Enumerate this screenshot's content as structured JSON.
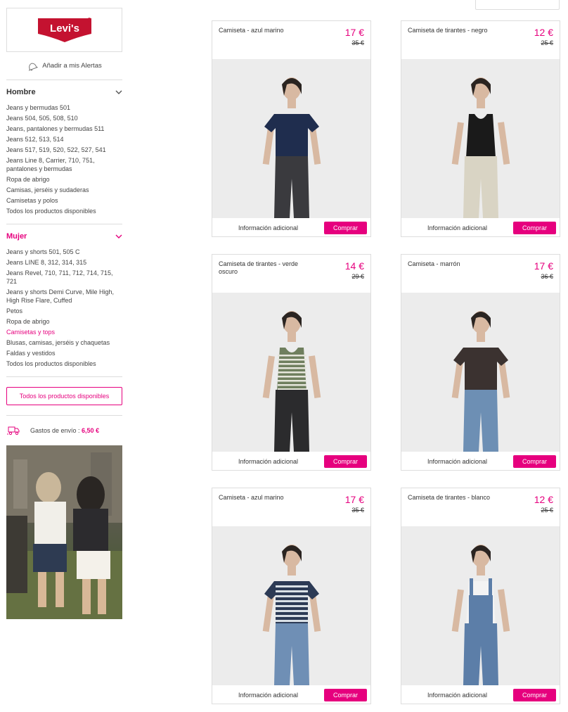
{
  "brand": {
    "logo_text": "Levi's",
    "accent": "#e6007e",
    "logo_red": "#c41230"
  },
  "alerts_label": "Añadir a mis Alertas",
  "hombre": {
    "title": "Hombre",
    "items": [
      "Jeans y bermudas 501",
      "Jeans 504, 505, 508, 510",
      "Jeans, pantalones y bermudas 511",
      "Jeans 512, 513, 514",
      "Jeans 517, 519, 520, 522, 527, 541",
      "Jeans Line 8, Carrier, 710, 751, pantalones y bermudas",
      "Ropa de abrigo",
      "Camisas, jerséis y sudaderas",
      "Camisetas y polos",
      "Todos los productos disponibles"
    ]
  },
  "mujer": {
    "title": "Mujer",
    "items": [
      "Jeans y shorts 501, 505 C",
      "Jeans LINE 8, 312, 314, 315",
      "Jeans Revel, 710, 711, 712, 714, 715, 721",
      "Jeans y shorts Demi Curve, Mile High, High Rise Flare, Cuffed",
      "Petos",
      "Ropa de abrigo",
      "Camisetas y tops",
      "Blusas, camisas, jerséis y chaquetas",
      "Faldas y vestidos",
      "Todos los productos disponibles"
    ],
    "active_index": 6
  },
  "all_products_button": "Todos los productos disponibles",
  "shipping": {
    "label": "Gastos de envío : ",
    "value": "6,50 €"
  },
  "products": [
    {
      "name": "Camiseta - azul marino",
      "price": "17 €",
      "old_price": "35 €",
      "info": "Información adicional",
      "buy": "Comprar",
      "top_color": "#1f2d4e",
      "top_style": "tee",
      "bottom_color": "#3a3a3e"
    },
    {
      "name": "Camiseta de tirantes - negro",
      "price": "12 €",
      "old_price": "25 €",
      "info": "Información adicional",
      "buy": "Comprar",
      "top_color": "#1a1a1a",
      "top_style": "tank",
      "bottom_color": "#d9d4c4"
    },
    {
      "name": "Camiseta de tirantes - verde oscuro",
      "price": "14 €",
      "old_price": "29 €",
      "info": "Información adicional",
      "buy": "Comprar",
      "top_color": "#6f7f5e",
      "top_style": "tank-stripe",
      "bottom_color": "#2b2b2d"
    },
    {
      "name": "Camiseta - marrón",
      "price": "17 €",
      "old_price": "36 €",
      "info": "Información adicional",
      "buy": "Comprar",
      "top_color": "#3b3230",
      "top_style": "tee",
      "bottom_color": "#6d8fb4"
    },
    {
      "name": "Camiseta - azul marino",
      "price": "17 €",
      "old_price": "35 €",
      "info": "Información adicional",
      "buy": "Comprar",
      "top_color": "#2c3a55",
      "top_style": "tee-stripe",
      "bottom_color": "#6f8fb5"
    },
    {
      "name": "Camiseta de tirantes - blanco",
      "price": "12 €",
      "old_price": "25 €",
      "info": "Información adicional",
      "buy": "Comprar",
      "top_color": "#f3f3f3",
      "top_style": "overall",
      "bottom_color": "#5c7ea8"
    }
  ],
  "icons": {
    "bell": "bell-icon",
    "chevron": "chevron-down-icon",
    "truck": "truck-icon"
  }
}
